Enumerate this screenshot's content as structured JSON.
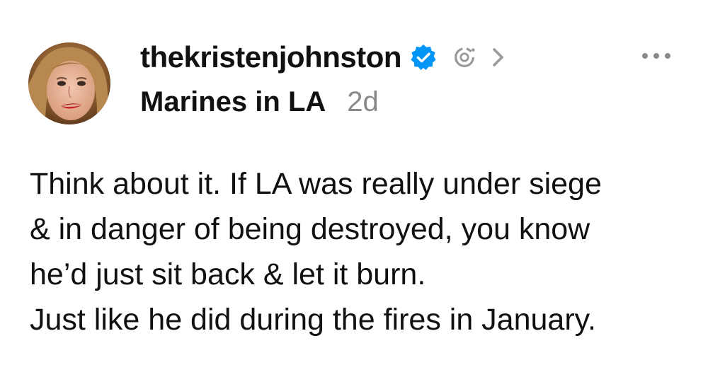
{
  "post": {
    "author": {
      "username": "thekristenjohnston",
      "verified": true,
      "avatar_icon": "profile-photo"
    },
    "topic": "Marines in LA",
    "timestamp": "2d",
    "body_lines": [
      "Think about it. If LA was really under siege",
      "& in danger of being destroyed, you know",
      "he’d just sit back & let it burn.",
      "Just like he did during the fires in January."
    ],
    "icons": {
      "verified": "verified-badge-icon",
      "threads": "threads-circle-icon",
      "chevron": "chevron-right-icon",
      "more": "more-options-icon"
    },
    "colors": {
      "verified_blue": "#0095F6",
      "text": "#111111",
      "muted": "#8A8A8A",
      "icon_gray": "#9A9A9A"
    }
  }
}
